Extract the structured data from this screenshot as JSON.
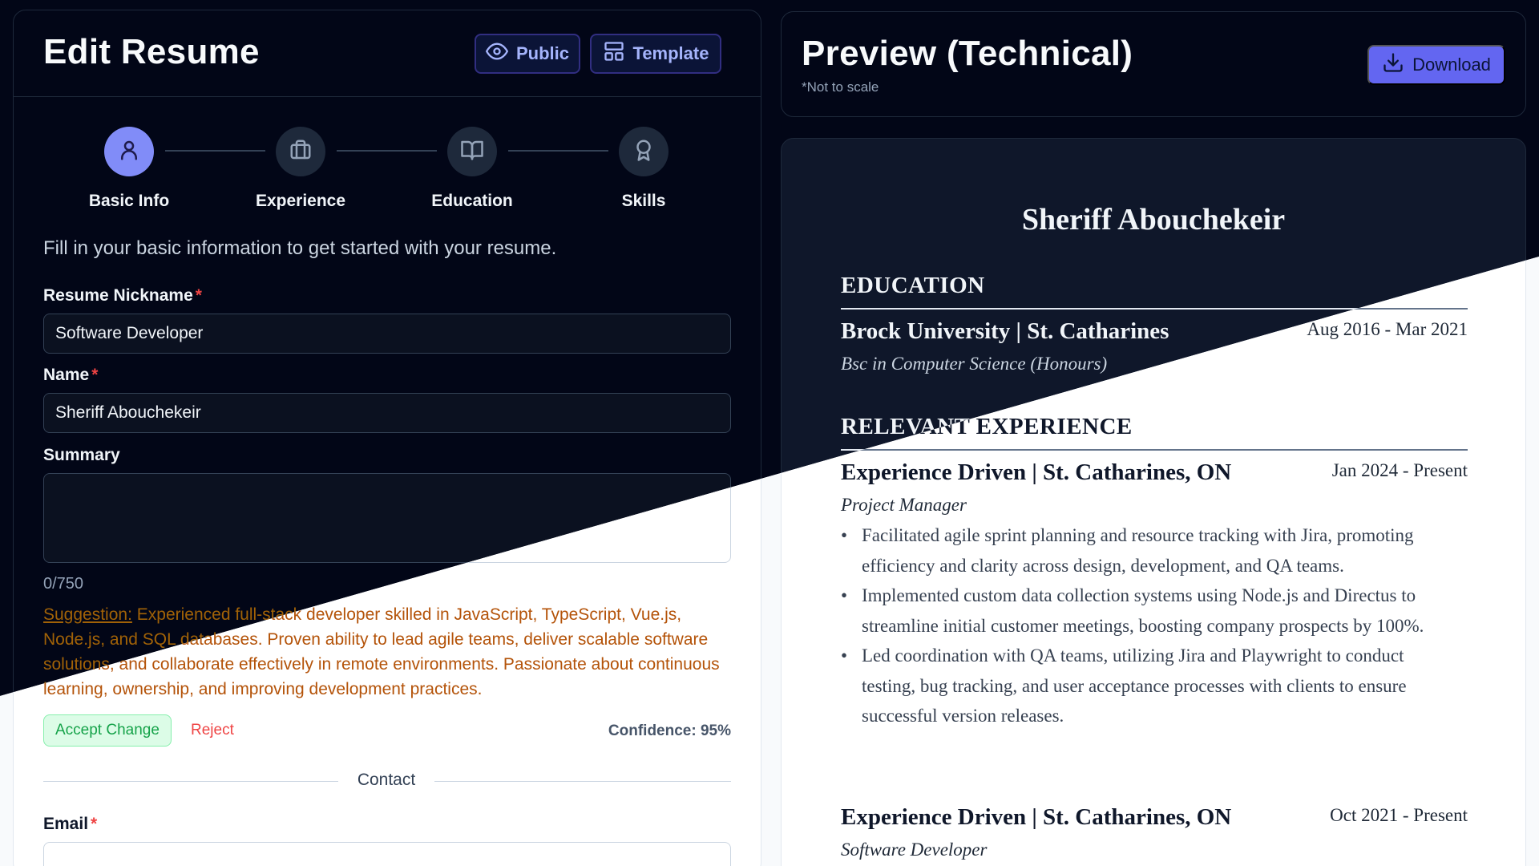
{
  "editor": {
    "title": "Edit Resume",
    "public_label": "Public",
    "template_label": "Template",
    "steps": [
      {
        "label": "Basic Info",
        "icon": "user-icon",
        "active": true
      },
      {
        "label": "Experience",
        "icon": "briefcase-icon",
        "active": false
      },
      {
        "label": "Education",
        "icon": "book-open-icon",
        "active": false
      },
      {
        "label": "Skills",
        "icon": "award-icon",
        "active": false
      }
    ],
    "intro": "Fill in your basic information to get started with your resume.",
    "required_mark": "*",
    "nickname_label": "Resume Nickname",
    "nickname_value": "Software Developer",
    "name_label": "Name",
    "name_value": "Sheriff Abouchekeir",
    "summary_label": "Summary",
    "summary_value": "",
    "summary_counter": "0/750",
    "suggestion_label": "Suggestion:",
    "suggestion_text": " Experienced full-stack developer skilled in JavaScript, TypeScript, Vue.js, Node.js, and SQL databases. Proven ability to lead agile teams, deliver scalable software solutions, and collaborate effectively in remote environments. Passionate about continuous learning, ownership, and improving development practices.",
    "accept_label": "Accept Change",
    "reject_label": "Reject",
    "confidence_label": "Confidence: 95%",
    "contact_label": "Contact",
    "email_label": "Email",
    "email_value": ""
  },
  "preview": {
    "title": "Preview (Technical)",
    "note": "*Not to scale",
    "download_label": "Download",
    "resume": {
      "name": "Sheriff Abouchekeir",
      "education_heading": "EDUCATION",
      "education": [
        {
          "org": "Brock University | St. Catharines",
          "dates": "Aug 2016 - Mar 2021",
          "degree": "Bsc in Computer Science (Honours)"
        }
      ],
      "experience_heading": "RELEVANT EXPERIENCE",
      "experience": [
        {
          "org": "Experience Driven | St. Catharines, ON",
          "dates": "Jan 2024 - Present",
          "role": "Project Manager",
          "bullets": [
            "Facilitated agile sprint planning and resource tracking with Jira, promoting efficiency and clarity across design, development, and QA teams.",
            "Implemented custom data collection systems using Node.js and Directus to streamline initial customer meetings, boosting company prospects by 100%.",
            "Led coordination with QA teams, utilizing Jira and Playwright to conduct testing, bug tracking, and user acceptance processes with clients to ensure successful version releases."
          ]
        },
        {
          "org": "Experience Driven | St. Catharines, ON",
          "dates": "Oct 2021 - Present",
          "role": "Software Developer",
          "bullets": []
        }
      ]
    }
  },
  "colors": {
    "accent": "#6366f1",
    "required": "#ef4444",
    "accept": "#16a34a",
    "suggestion": "#b45309"
  }
}
